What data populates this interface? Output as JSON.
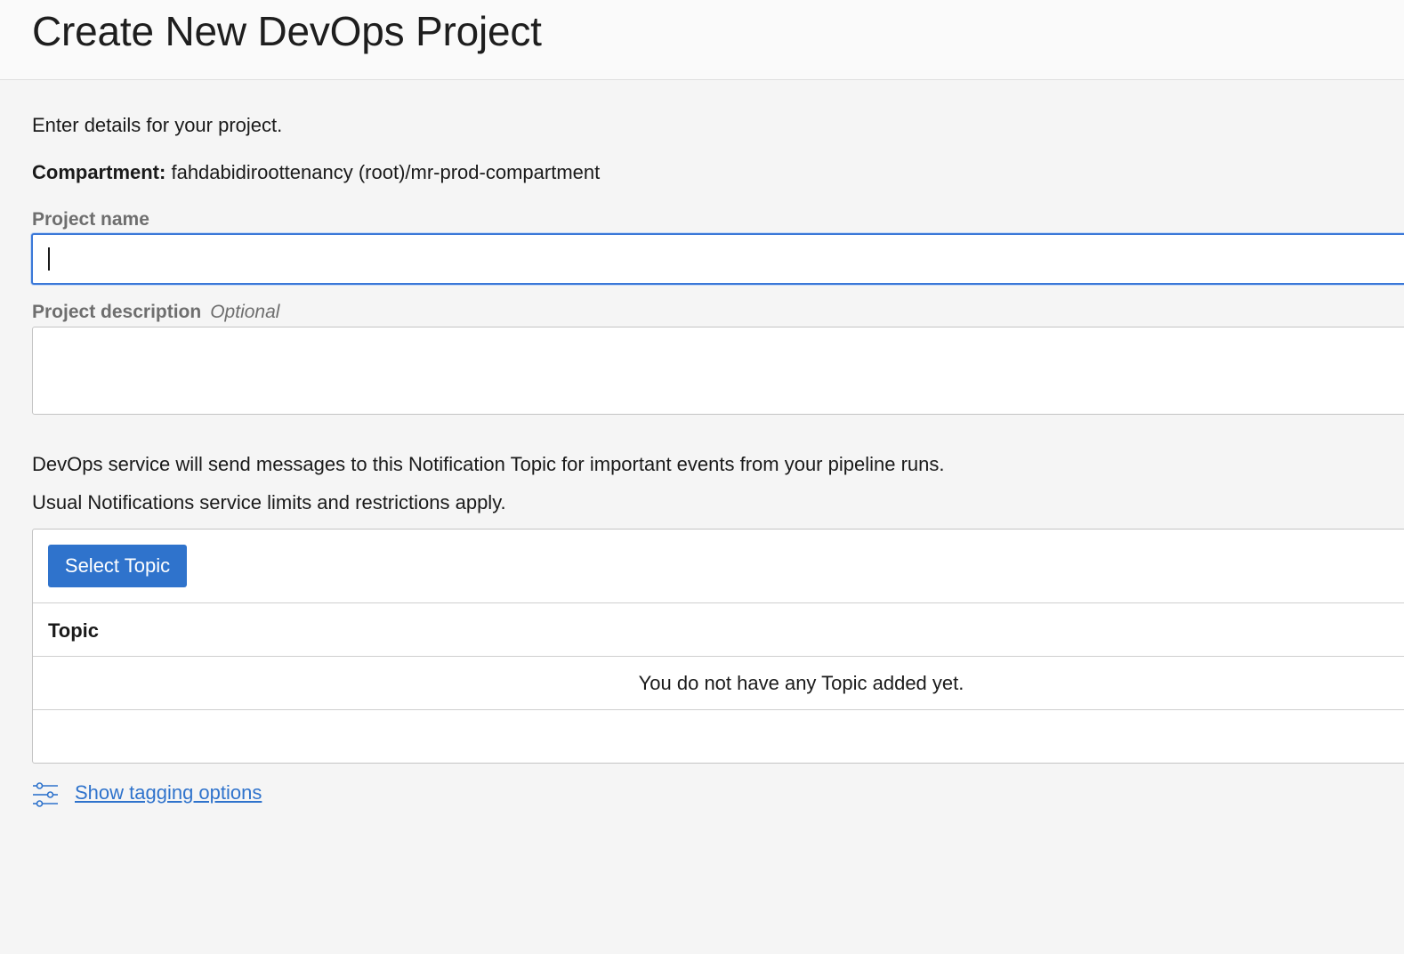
{
  "header": {
    "title": "Create New DevOps Project"
  },
  "form": {
    "intro": "Enter details for your project.",
    "compartment_label": "Compartment:",
    "compartment_value": "fahdabidiroottenancy (root)/mr-prod-compartment",
    "project_name_label": "Project name",
    "project_name_value": "",
    "project_description_label": "Project description",
    "project_description_optional": "Optional",
    "project_description_value": ""
  },
  "notifications": {
    "line1": "DevOps service will send messages to this Notification Topic for important events from your pipeline runs.",
    "line2": "Usual Notifications service limits and restrictions apply.",
    "select_button": "Select Topic",
    "table": {
      "columns": [
        "Topic"
      ],
      "empty_message": "You do not have any Topic added yet."
    }
  },
  "tagging": {
    "icon": "sliders-icon",
    "link": "Show tagging options"
  },
  "colors": {
    "accent": "#2f73cc",
    "focus_border": "#3b78d8"
  }
}
